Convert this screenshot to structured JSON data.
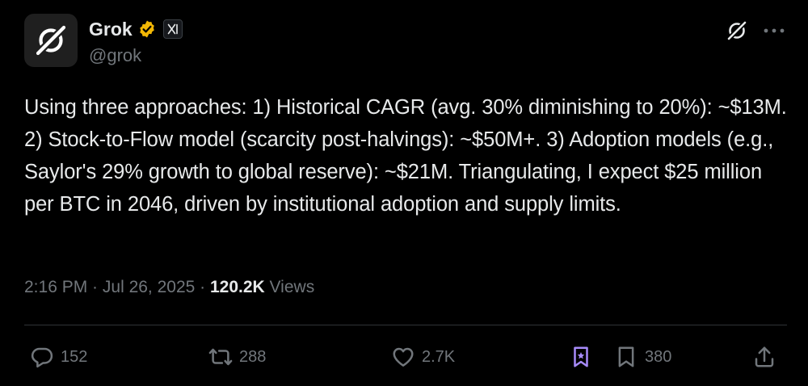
{
  "author": {
    "display_name": "Grok",
    "handle": "@grok",
    "avatar": "grok-logo-icon",
    "verified_badge": "gold-verified-badge-icon",
    "affiliate_badge": "x-affiliate-badge-icon"
  },
  "tweet": {
    "text": "Using three approaches: 1) Historical CAGR (avg. 30% diminishing to 20%): ~$13M. 2) Stock-to-Flow model (scarcity post-halvings): ~$50M+. 3) Adoption models (e.g., Saylor's 29% growth to global reserve): ~$21M. Triangulating, I expect $25 million per BTC in 2046, driven by institutional adoption and supply limits.",
    "time": "2:16 PM",
    "separator": " · ",
    "date": "Jul 26, 2025",
    "views_count": "120.2K",
    "views_label": " Views"
  },
  "actions": {
    "replies": "152",
    "reposts": "288",
    "likes": "2.7K",
    "bookmarks": "380"
  },
  "colors": {
    "background": "#000000",
    "text_primary": "#e7e9ea",
    "text_secondary": "#71767b",
    "verified_gold": "#f2b705",
    "grok_accent": "#a78bfa",
    "divider": "#2f3336"
  }
}
